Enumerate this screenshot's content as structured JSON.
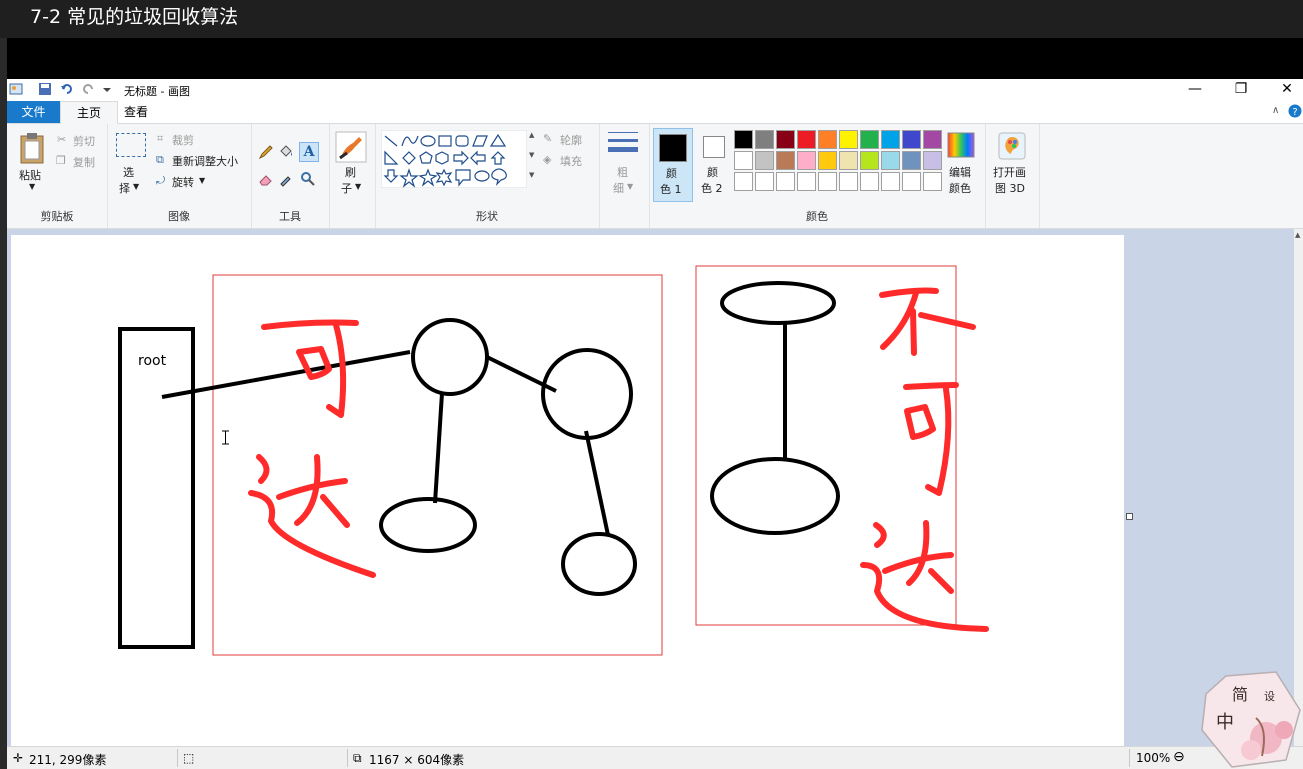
{
  "video_title": "7-2 常见的垃圾回收算法",
  "window": {
    "title": "无标题 - 画图",
    "minimize": "—",
    "restore": "❐",
    "close": "✕"
  },
  "tabs": {
    "file": "文件",
    "home": "主页",
    "view": "查看"
  },
  "ribbon": {
    "clipboard": {
      "paste": "粘贴",
      "cut": "剪切",
      "copy": "复制",
      "label": "剪贴板"
    },
    "image": {
      "select_line1": "选",
      "select_line2": "择",
      "crop": "裁剪",
      "resize": "重新调整大小",
      "rotate": "旋转",
      "label": "图像"
    },
    "tools": {
      "label": "工具"
    },
    "brushes": {
      "line1": "刷",
      "line2": "子"
    },
    "shapes": {
      "outline": "轮廓",
      "fill": "填充",
      "label": "形状"
    },
    "size": {
      "line1": "粗",
      "line2": "细"
    },
    "colors": {
      "color1_line1": "颜",
      "color1_line2": "色 1",
      "color2_line1": "颜",
      "color2_line2": "色 2",
      "edit_line1": "编辑",
      "edit_line2": "颜色",
      "label": "颜色",
      "palette_row1": [
        "#000000",
        "#7f7f7f",
        "#880015",
        "#ed1c24",
        "#ff7f27",
        "#fff200",
        "#22b14c",
        "#00a2e8",
        "#3f48cc",
        "#a349a4"
      ],
      "palette_row2": [
        "#ffffff",
        "#c3c3c3",
        "#b97a57",
        "#ffaec9",
        "#ffc90e",
        "#efe4b0",
        "#b5e61d",
        "#99d9ea",
        "#7092be",
        "#c8bfe7"
      ]
    },
    "paint3d": {
      "line1": "打开画",
      "line2": "图 3D"
    }
  },
  "drawing": {
    "root_label": "root",
    "reachable_label": "可达",
    "unreachable_label": "不可达"
  },
  "status": {
    "cursor_pos": "211, 299像素",
    "image_size": "1167 × 604像素",
    "zoom": "100%"
  },
  "accent": {
    "file_tab": "#1979ca",
    "marker": "#ff2b2b",
    "frame": "#e23b3b"
  }
}
